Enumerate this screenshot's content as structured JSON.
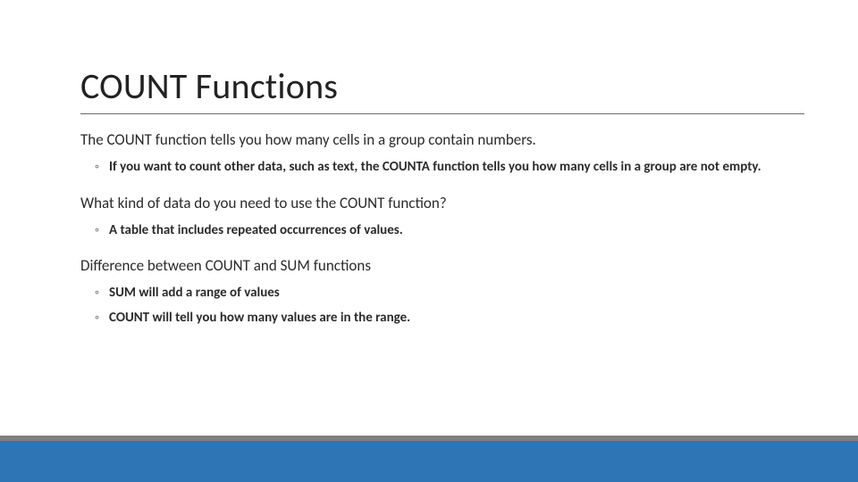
{
  "title": "COUNT Functions",
  "sections": [
    {
      "heading": "The COUNT function tells you how many cells in a group contain numbers.",
      "bullets": [
        "If you want to count other data, such as text, the COUNTA function tells you how many cells in a group are not empty."
      ]
    },
    {
      "heading": "What kind of data do you need to use the COUNT function?",
      "bullets": [
        "A table that includes repeated occurrences of values."
      ]
    },
    {
      "heading": "Difference between COUNT and SUM functions",
      "bullets": [
        "SUM will add a range of values",
        "COUNT will tell you how many values are in the range."
      ]
    }
  ],
  "theme": {
    "accent_bar_color": "#2e75b6",
    "divider_color": "#7f7f7f"
  }
}
